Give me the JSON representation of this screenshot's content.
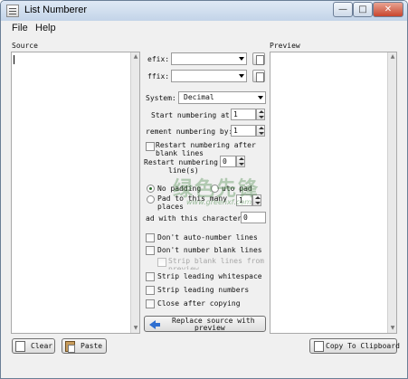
{
  "window": {
    "title": "List Numberer"
  },
  "menu": [
    "File",
    "Help"
  ],
  "source": {
    "label": "Source",
    "text": ""
  },
  "preview": {
    "label": "Preview"
  },
  "options": {
    "prefix_label": "efix:",
    "suffix_label": "ffix:",
    "system_label": "System:",
    "system_value": "Decimal",
    "start_label": "Start numbering at:",
    "start_value": "1",
    "increment_label": "rement numbering by:",
    "increment_value": "1",
    "restart_blank_label": "Restart numbering after blank lines",
    "restart_every_label_1": "Restart numbering ev",
    "restart_every_value": "0",
    "restart_every_label_2": "line(s)",
    "no_padding_label": "No padding",
    "auto_pad_label": "uto pad",
    "pad_to_label_1": "Pad to this many",
    "pad_to_label_2": "places",
    "pad_to_value": "1",
    "pad_char_label": "ad with this character:",
    "pad_char_value": "0"
  },
  "checks": {
    "no_auto_number": "Don't auto-number lines",
    "no_number_blank": "Don't number blank lines",
    "strip_blank_1": "Strip blank lines from",
    "strip_blank_2": "preview",
    "strip_whitespace": "Strip leading whitespace",
    "strip_numbers": "Strip leading numbers",
    "close_after_copy": "Close after copying"
  },
  "buttons": {
    "replace_1": "Replace source with",
    "replace_2": "preview",
    "clear": "Clear",
    "paste": "Paste",
    "copy": "Copy To Clipboard"
  },
  "watermark": {
    "text": "绿色先锋",
    "url": "www.greenxf.com"
  }
}
